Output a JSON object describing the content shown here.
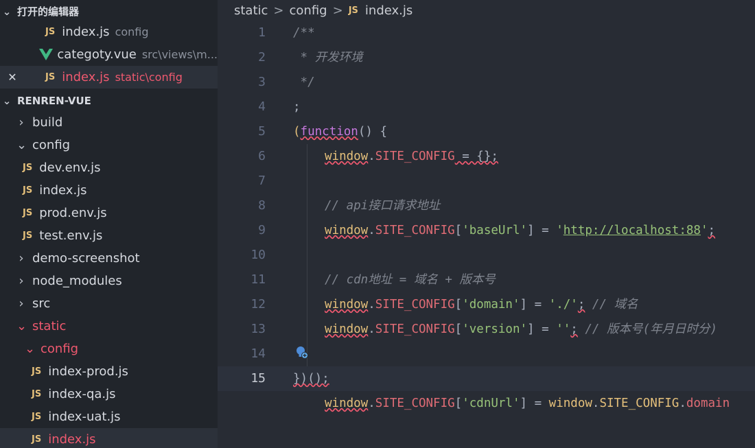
{
  "sidebar": {
    "open_editors_title": "打开的编辑器",
    "open_editors": [
      {
        "icon": "JS",
        "name": "index.js",
        "desc": "config"
      },
      {
        "icon": "vue",
        "name": "categoty.vue",
        "desc": "src\\views\\m..."
      },
      {
        "icon": "JS",
        "name": "index.js",
        "desc": "static\\config",
        "close": "✕"
      }
    ],
    "project_title": "RENREN-VUE",
    "tree": [
      {
        "type": "folder",
        "name": "build"
      },
      {
        "type": "folder",
        "name": "config"
      },
      {
        "type": "file",
        "icon": "JS",
        "name": "dev.env.js"
      },
      {
        "type": "file",
        "icon": "JS",
        "name": "index.js"
      },
      {
        "type": "file",
        "icon": "JS",
        "name": "prod.env.js"
      },
      {
        "type": "file",
        "icon": "JS",
        "name": "test.env.js"
      },
      {
        "type": "folder",
        "name": "demo-screenshot"
      },
      {
        "type": "folder",
        "name": "node_modules"
      },
      {
        "type": "folder",
        "name": "src"
      },
      {
        "type": "folder",
        "name": "static"
      },
      {
        "type": "folder",
        "name": "config"
      },
      {
        "type": "file",
        "icon": "JS",
        "name": "index-prod.js"
      },
      {
        "type": "file",
        "icon": "JS",
        "name": "index-qa.js"
      },
      {
        "type": "file",
        "icon": "JS",
        "name": "index-uat.js"
      },
      {
        "type": "file",
        "icon": "JS",
        "name": "index.js"
      }
    ]
  },
  "breadcrumb": {
    "part1": "static",
    "part2": "config",
    "file_icon": "JS",
    "file": "index.js",
    "separator": ">"
  },
  "code": {
    "line_numbers": [
      "1",
      "2",
      "3",
      "4",
      "5",
      "6",
      "7",
      "8",
      "9",
      "10",
      "11",
      "12",
      "13",
      "14",
      "15"
    ],
    "l1": "/**",
    "l2": " * 开发环境",
    "l3": " */",
    "l4": ";",
    "l5_open": "(",
    "l5_kw": "function",
    "l5_rest": "() {",
    "window": "window",
    "dot": ".",
    "site_config": "SITE_CONFIG",
    "l6_rest": " = {};",
    "l8_comment": "// api接口请求地址",
    "l9_key": "'baseUrl'",
    "l9_eq": "] = ",
    "l9_str_open": "'",
    "l9_url": "http://localhost:88",
    "l9_str_close": "'",
    "l9_semi": ";",
    "l11_comment": "// cdn地址 = 域名 + 版本号",
    "l12_key": "'domain'",
    "l12_val": "'./'",
    "l12_comment": "// 域名",
    "l13_key": "'version'",
    "l13_val": "''",
    "l13_comment": "// 版本号(年月日时分)",
    "l14_key": "'cdnUrl'",
    "l14_tail": "domain",
    "l15": "})();"
  },
  "colors": {
    "background": "#282c34",
    "sidebar": "#21252b",
    "keyword": "#c678dd",
    "variable": "#e5c07b",
    "property": "#e06c75",
    "string": "#98c379",
    "comment": "#7f848e",
    "error": "#ef596f"
  }
}
